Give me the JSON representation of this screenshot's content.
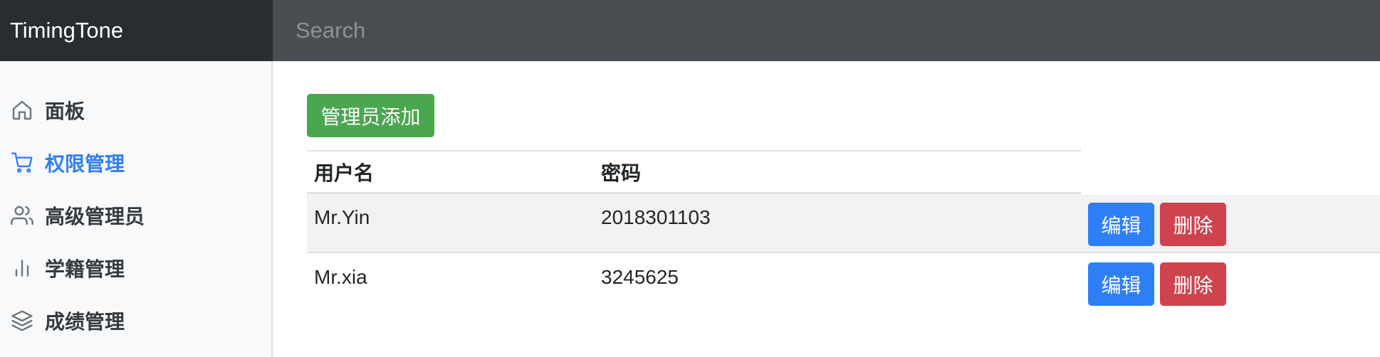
{
  "app": {
    "brand": "TimingTone"
  },
  "search": {
    "placeholder": "Search",
    "value": ""
  },
  "sidebar": {
    "items": [
      {
        "label": "面板",
        "icon": "home-icon",
        "active": false
      },
      {
        "label": "权限管理",
        "icon": "shopping-cart-icon",
        "active": true
      },
      {
        "label": "高级管理员",
        "icon": "users-icon",
        "active": false
      },
      {
        "label": "学籍管理",
        "icon": "bar-chart-icon",
        "active": false
      },
      {
        "label": "成绩管理",
        "icon": "layers-icon",
        "active": false
      }
    ]
  },
  "main": {
    "add_button": "管理员添加",
    "table": {
      "headers": [
        "用户名",
        "密码"
      ],
      "rows": [
        {
          "username": "Mr.Yin",
          "password": "2018301103",
          "edit": "编辑",
          "delete": "删除"
        },
        {
          "username": "Mr.xia",
          "password": "3245625",
          "edit": "编辑",
          "delete": "删除"
        }
      ]
    }
  },
  "colors": {
    "brand_bg": "#2a2d30",
    "search_bg": "#4a4d51",
    "active_nav": "#2f7ff6",
    "add_button": "#4aa64f",
    "edit_button": "#2e7ff6",
    "delete_button": "#cd434e"
  }
}
